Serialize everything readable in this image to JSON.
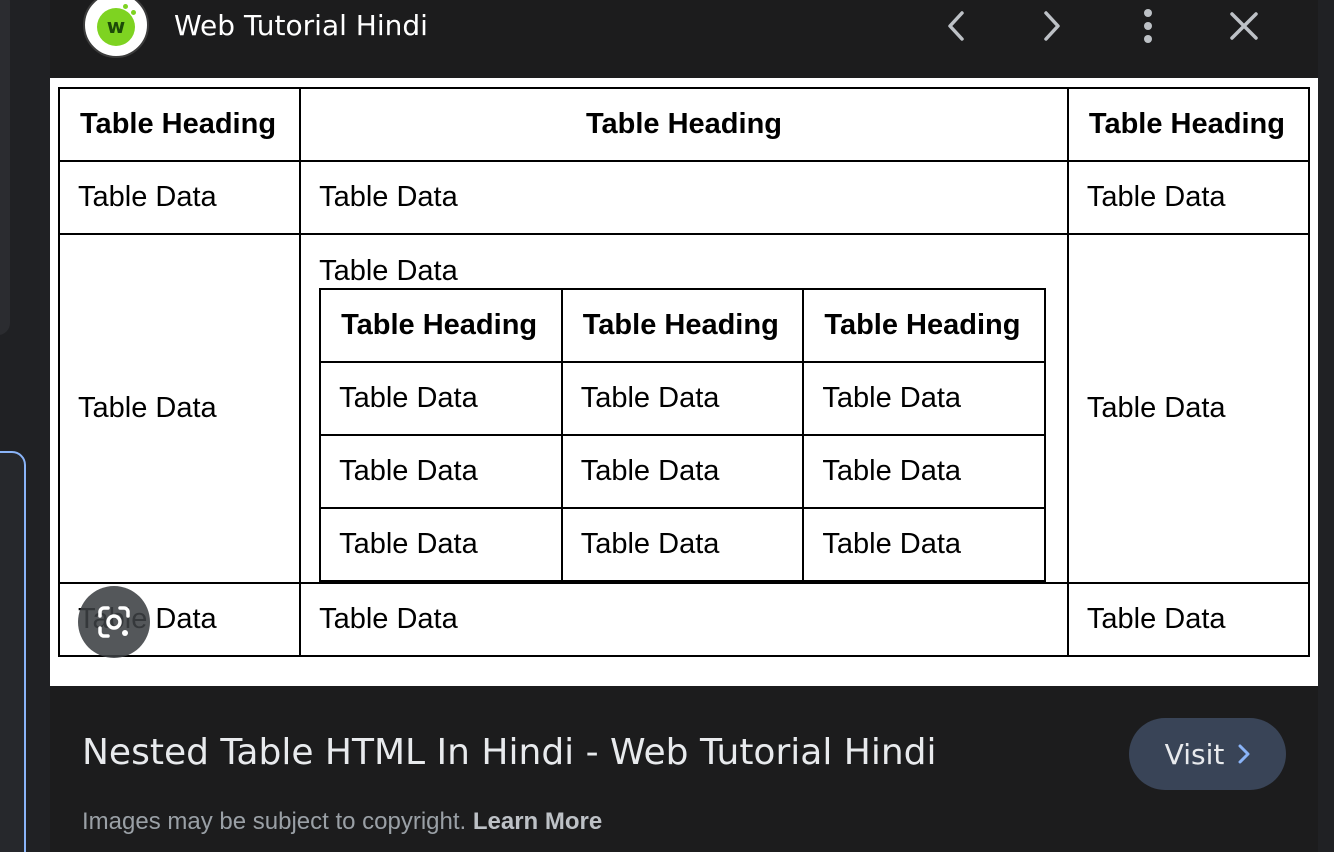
{
  "header": {
    "site_name": "Web Tutorial Hindi",
    "logo_letter": "w",
    "prev_icon": "chevron-left-icon",
    "next_icon": "chevron-right-icon",
    "more_icon": "more-vert-icon",
    "close_icon": "close-icon"
  },
  "table": {
    "headings": [
      "Table Heading",
      "Table Heading",
      "Table Heading"
    ],
    "row1": [
      "Table Data",
      "Table Data",
      "Table Data"
    ],
    "row2_left": "Table Data",
    "row2_right": "Table Data",
    "nested_caption": "Table Data",
    "nested_headings": [
      "Table Heading",
      "Table Heading",
      "Table Heading"
    ],
    "nested_rows": [
      [
        "Table Data",
        "Table Data",
        "Table Data"
      ],
      [
        "Table Data",
        "Table Data",
        "Table Data"
      ],
      [
        "Table Data",
        "Table Data",
        "Table Data"
      ]
    ],
    "row3": [
      "Table Data",
      "Table Data",
      "Table Data"
    ]
  },
  "lens_icon": "lens-camera-icon",
  "result": {
    "title": "Nested Table HTML In Hindi - Web Tutorial Hindi",
    "visit_label": "Visit",
    "copyright_text": "Images may be subject to copyright.",
    "learn_more": "Learn More"
  },
  "colors": {
    "panel_bg": "#1c1c1d",
    "visit_bg": "#394457",
    "accent_border": "#8ab4f8",
    "logo_green": "#7ed321"
  }
}
